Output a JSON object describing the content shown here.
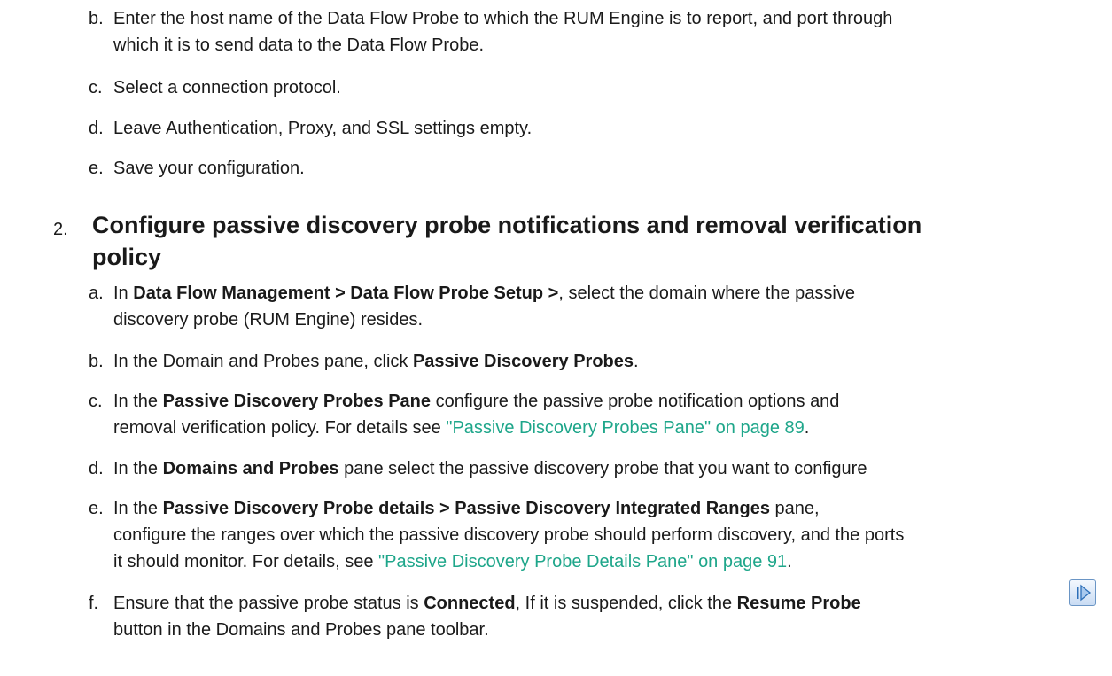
{
  "sub_items_top": [
    {
      "letter": "b.",
      "lines": [
        "Enter the host name of the Data Flow Probe to which the RUM Engine is to report, and port through",
        "which it is to send data to the Data Flow Probe."
      ]
    },
    {
      "letter": "c.",
      "lines": [
        "Select a connection protocol."
      ]
    },
    {
      "letter": "d.",
      "lines": [
        "Leave Authentication, Proxy, and SSL settings empty."
      ]
    },
    {
      "letter": "e.",
      "lines": [
        "Save your configuration."
      ]
    }
  ],
  "step2": {
    "number": "2.",
    "title_line1": "Configure passive discovery probe notifications and removal verification",
    "title_line2": "policy"
  },
  "step2_items": {
    "a": {
      "letter": "a.",
      "pre": "In ",
      "bold": "Data Flow Management > Data Flow Probe Setup >",
      "post": ", select the domain where the passive",
      "line2": "discovery probe (RUM Engine) resides."
    },
    "b": {
      "letter": "b.",
      "pre": "In the Domain and Probes pane, click ",
      "bold": "Passive Discovery Probes",
      "post": "."
    },
    "c": {
      "letter": "c.",
      "pre": "In the ",
      "bold": "Passive Discovery Probes Pane",
      "post": " configure the passive probe notification options and",
      "line2_pre": "removal verification policy. For details see ",
      "link": "\"Passive Discovery Probes Pane\" on page 89",
      "line2_post": "."
    },
    "d": {
      "letter": "d.",
      "pre": "In the ",
      "bold": "Domains and Probes",
      "post": " pane select the passive discovery probe that you want to configure"
    },
    "e": {
      "letter": "e.",
      "pre": "In the ",
      "bold": "Passive Discovery Probe details > Passive Discovery Integrated Ranges",
      "post": " pane,",
      "line2": "configure the ranges over which the passive discovery probe should perform discovery, and the ports",
      "line3_pre": "it should monitor. For details, see ",
      "link": "\"Passive Discovery Probe Details Pane\" on page 91",
      "line3_post": "."
    },
    "f": {
      "letter": "f.",
      "pre": "Ensure that the passive probe status is ",
      "bold1": "Connected",
      "mid": ", If it is suspended, click the ",
      "bold2": "Resume Probe",
      "line2": "button in the Domains and Probes pane toolbar.",
      "icon": "resume-probe-icon"
    }
  },
  "colors": {
    "link": "#1ea68a",
    "text": "#1a1a1a"
  }
}
